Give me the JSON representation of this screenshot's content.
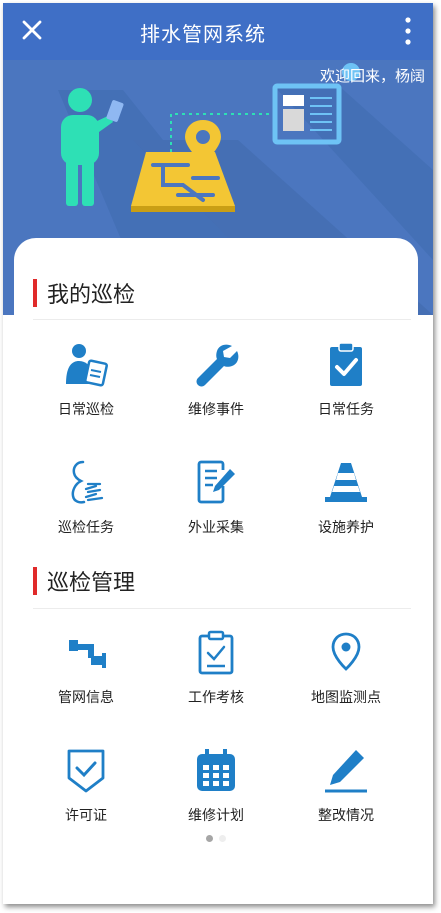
{
  "header": {
    "title": "排水管网系统",
    "close_icon": "close-icon",
    "menu_icon": "more-vertical-icon"
  },
  "hero": {
    "welcome": "欢迎回来，杨阔"
  },
  "sections": [
    {
      "title": "我的巡检",
      "items": [
        {
          "label": "日常巡检",
          "icon": "inspector-clipboard-icon"
        },
        {
          "label": "维修事件",
          "icon": "wrench-icon"
        },
        {
          "label": "日常任务",
          "icon": "clipboard-check-icon"
        },
        {
          "label": "巡检任务",
          "icon": "patrol-person-icon"
        },
        {
          "label": "外业采集",
          "icon": "form-edit-icon"
        },
        {
          "label": "设施养护",
          "icon": "traffic-cone-icon"
        }
      ]
    },
    {
      "title": "巡检管理",
      "items": [
        {
          "label": "管网信息",
          "icon": "pipe-icon"
        },
        {
          "label": "工作考核",
          "icon": "clipboard-check-icon"
        },
        {
          "label": "地图监测点",
          "icon": "map-pin-icon"
        },
        {
          "label": "许可证",
          "icon": "shield-check-icon"
        },
        {
          "label": "维修计划",
          "icon": "calendar-icon"
        },
        {
          "label": "整改情况",
          "icon": "pen-edit-icon"
        }
      ]
    }
  ],
  "pager": {
    "pages": 2,
    "current": 1
  },
  "colors": {
    "titlebar": "#3f6fc6",
    "hero": "#4b76bf",
    "icon": "#1f7fc7",
    "accent": "#e02a2a"
  }
}
